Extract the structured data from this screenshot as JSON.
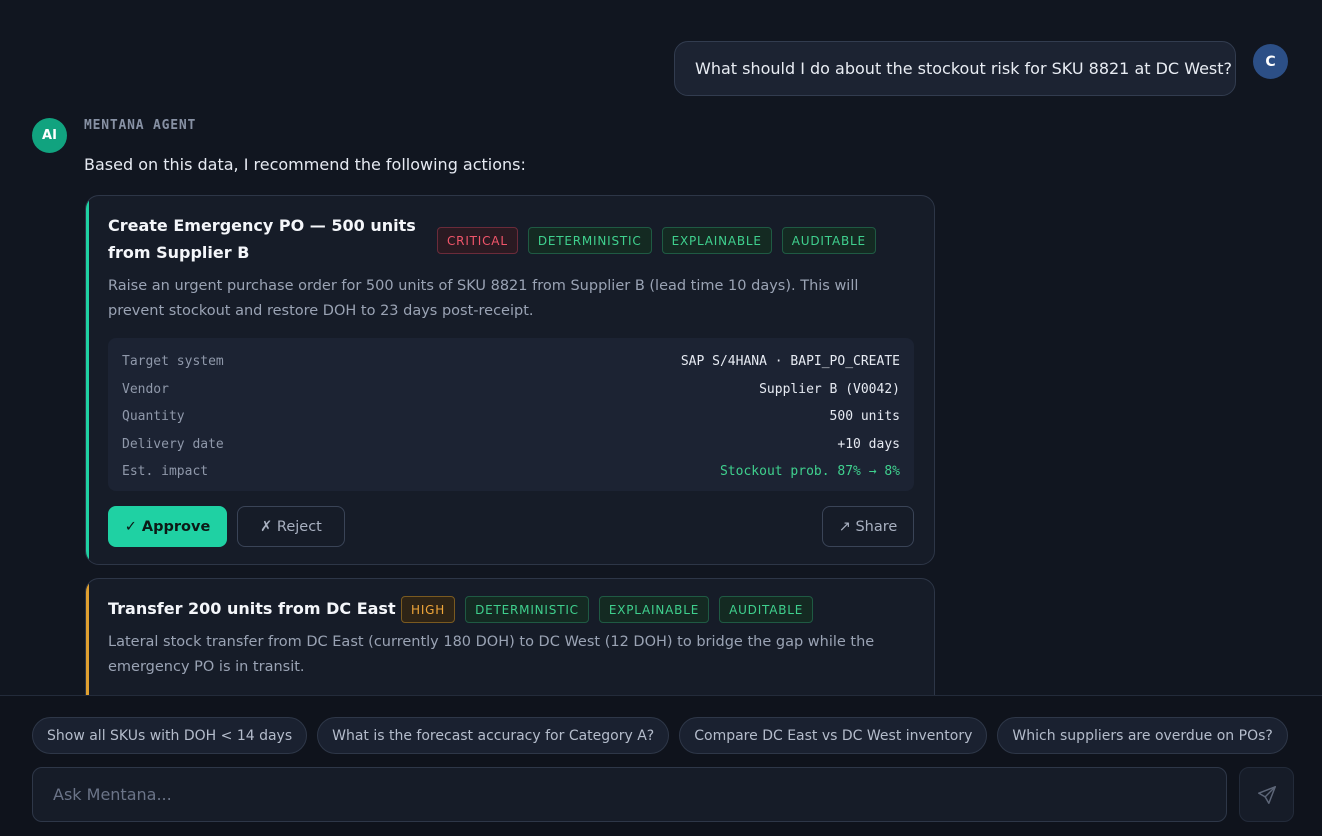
{
  "user": {
    "avatar_initial": "C",
    "message": "What should I do about the stockout risk for SKU 8821 at DC West?"
  },
  "agent": {
    "avatar_label": "AI",
    "name": "MENTANA AGENT",
    "intro": "Based on this data, I recommend the following actions:"
  },
  "actions": [
    {
      "title": "Create Emergency PO — 500 units from Supplier B",
      "priority": "CRITICAL",
      "tags": [
        "DETERMINISTIC",
        "EXPLAINABLE",
        "AUDITABLE"
      ],
      "description": "Raise an urgent purchase order for 500 units of SKU 8821 from Supplier B (lead time 10 days). This will prevent stockout and restore DOH to 23 days post-receipt.",
      "details": [
        {
          "key": "Target system",
          "value": "SAP S/4HANA · BAPI_PO_CREATE"
        },
        {
          "key": "Vendor",
          "value": "Supplier B (V0042)"
        },
        {
          "key": "Quantity",
          "value": "500 units"
        },
        {
          "key": "Delivery date",
          "value": "+10 days"
        },
        {
          "key": "Est. impact",
          "value": "Stockout prob. 87% → 8%"
        }
      ],
      "approve_label": "✓ Approve",
      "reject_label": "✗ Reject",
      "share_label": "↗ Share"
    },
    {
      "title": "Transfer 200 units from DC East",
      "priority": "HIGH",
      "tags": [
        "DETERMINISTIC",
        "EXPLAINABLE",
        "AUDITABLE"
      ],
      "description": "Lateral stock transfer from DC East (currently 180 DOH) to DC West (12 DOH) to bridge the gap while the emergency PO is in transit."
    }
  ],
  "suggestions": [
    "Show all SKUs with DOH < 14 days",
    "What is the forecast accuracy for Category A?",
    "Compare DC East vs DC West inventory",
    "Which suppliers are overdue on POs?"
  ],
  "composer": {
    "placeholder": "Ask Mentana...",
    "send_icon": "send-icon"
  },
  "colors": {
    "background": "#111620",
    "accent": "#1fd1a3",
    "critical": "#f0556a",
    "high": "#f0a63a",
    "tag_green": "#3fd08e",
    "user_avatar": "#2c4f86",
    "agent_avatar": "#11a37f"
  }
}
